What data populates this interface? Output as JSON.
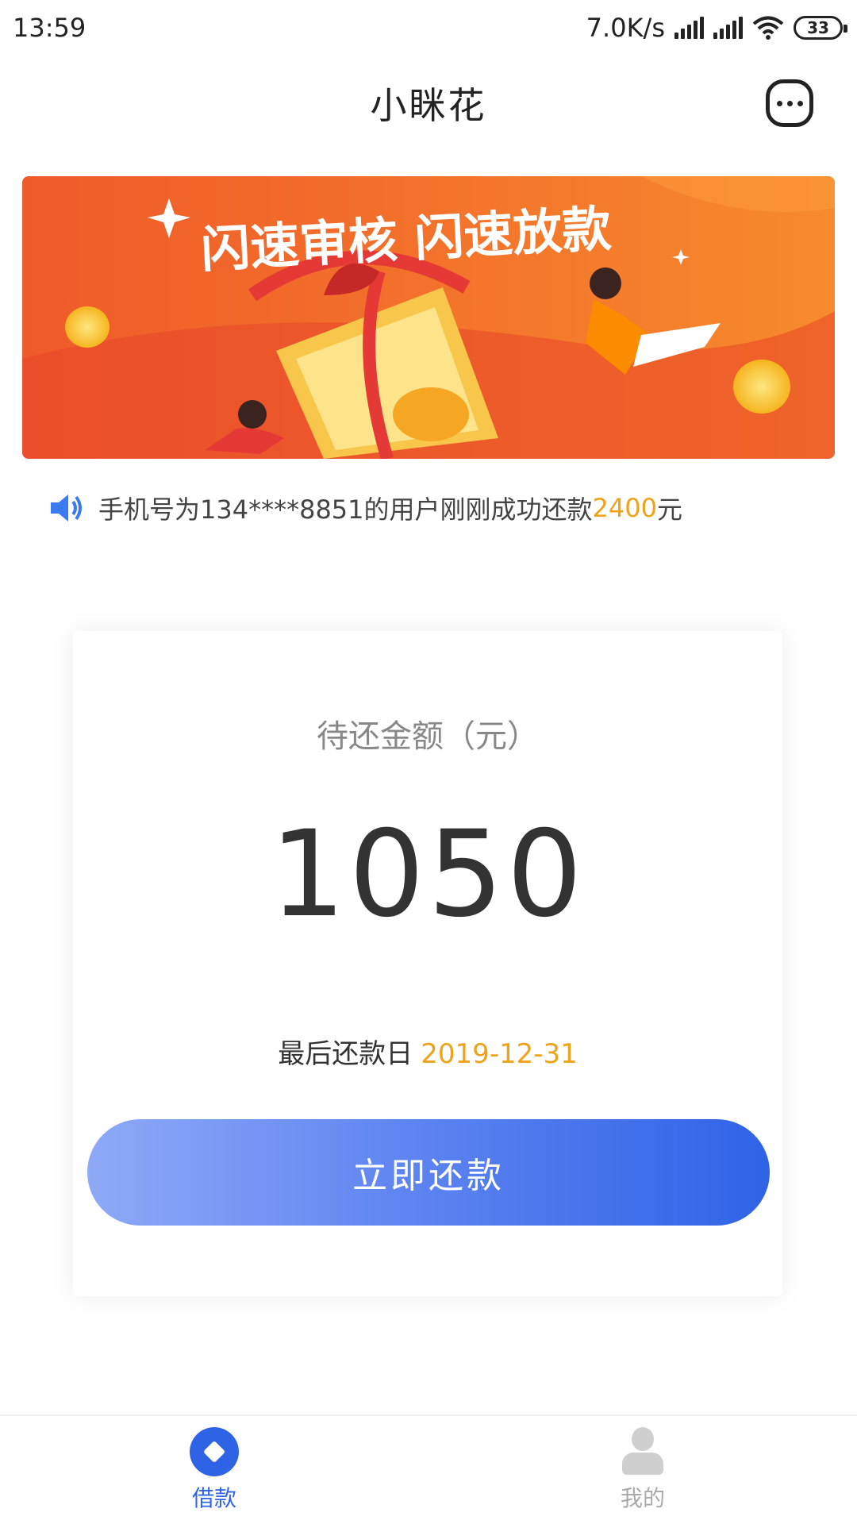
{
  "status_bar": {
    "time": "13:59",
    "network_speed": "7.0K/s",
    "battery": "33"
  },
  "header": {
    "title": "小眯花",
    "more_icon": "more-chat-icon"
  },
  "banner": {
    "headline": "闪速审核 闪速放款"
  },
  "notice": {
    "prefix": "手机号为134****8851的用户刚刚成功还款",
    "amount": "2400",
    "suffix": "元",
    "highlight_color": "#f0a21b"
  },
  "repayment": {
    "label": "待还金额（元）",
    "amount": "1050",
    "due_label": "最后还款日",
    "due_date": "2019-12-31",
    "button_label": "立即还款"
  },
  "bottom_nav": {
    "items": [
      {
        "label": "借款",
        "icon": "borrow-icon",
        "active": true
      },
      {
        "label": "我的",
        "icon": "user-icon",
        "active": false
      }
    ],
    "active_color": "#2f63e6"
  }
}
